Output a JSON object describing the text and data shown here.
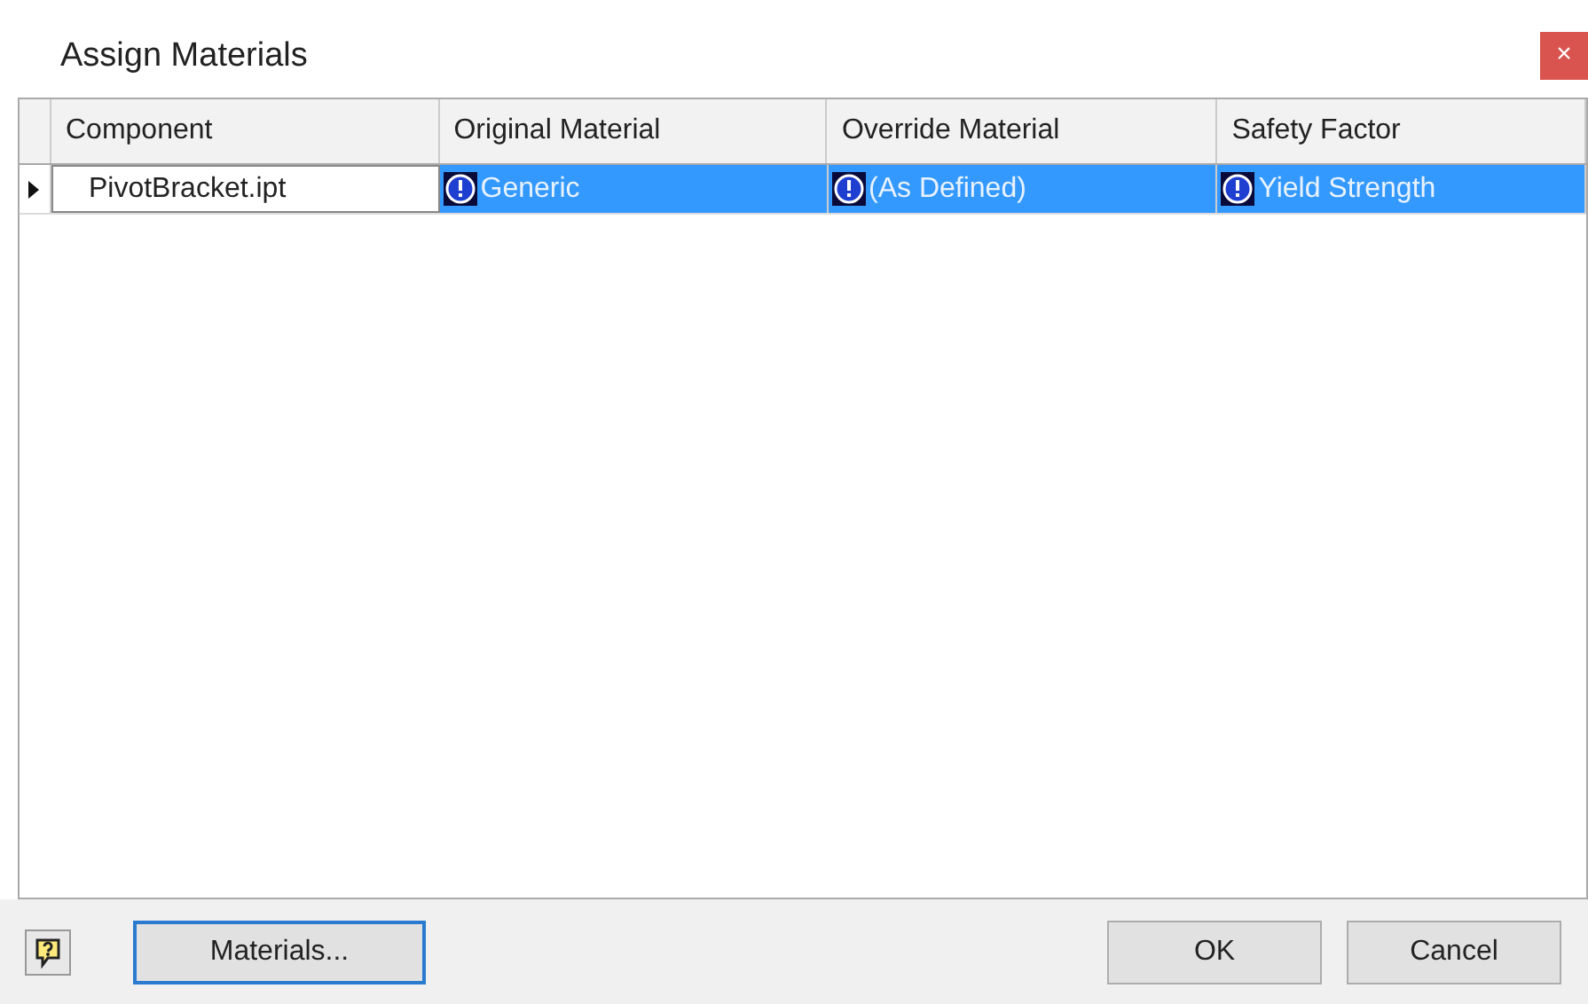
{
  "window": {
    "title": "Assign Materials",
    "close": "×"
  },
  "table": {
    "columns": [
      "Component",
      "Original Material",
      "Override Material",
      "Safety Factor"
    ],
    "rows": [
      {
        "selected": true,
        "cells": [
          {
            "text": "PivotBracket.ipt",
            "warning": false
          },
          {
            "text": "Generic",
            "warning": true
          },
          {
            "text": "(As Defined)",
            "warning": true
          },
          {
            "text": "Yield Strength",
            "warning": true
          }
        ]
      }
    ]
  },
  "buttons": {
    "materials": "Materials...",
    "ok": "OK",
    "cancel": "Cancel"
  }
}
